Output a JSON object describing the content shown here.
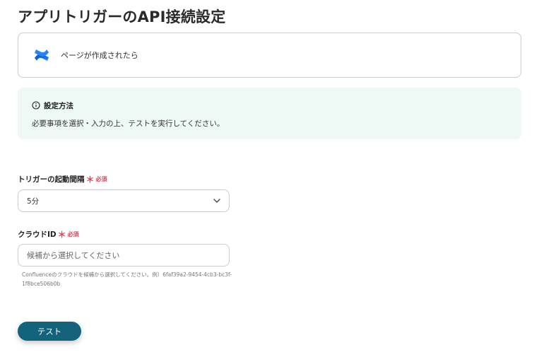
{
  "page": {
    "title": "アプリトリガーのAPI接続設定"
  },
  "trigger": {
    "label": "ページが作成されたら",
    "icon": "confluence-logo-icon"
  },
  "info": {
    "title": "設定方法",
    "description": "必要事項を選択・入力の上、テストを実行してください。"
  },
  "fields": {
    "interval": {
      "label": "トリガーの起動間隔",
      "required_mark": "＊",
      "required_text": "必須",
      "value": "5分"
    },
    "cloud_id": {
      "label": "クラウドID",
      "required_mark": "＊",
      "required_text": "必須",
      "placeholder": "候補から選択してください",
      "hint": "Confluenceのクラウドを候補から選択してください。例）6faf39a2-9454-4cb3-bc3f-1f8bce506b0b"
    }
  },
  "actions": {
    "test_label": "テスト"
  },
  "colors": {
    "accent": "#13637c",
    "required": "#e0455a",
    "info_bg": "#eef8f5"
  }
}
